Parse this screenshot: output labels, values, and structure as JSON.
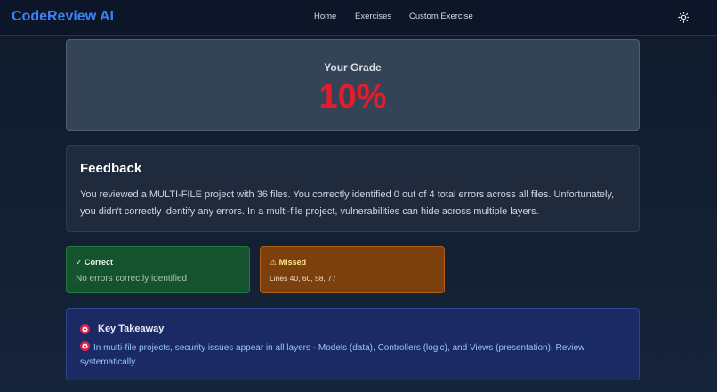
{
  "nav": {
    "brand": "CodeReview AI",
    "links": [
      "Home",
      "Exercises",
      "Custom Exercise"
    ],
    "theme_icon": "sun-icon"
  },
  "grade": {
    "label": "Your Grade",
    "value": "10%",
    "color": "#e11d2e"
  },
  "feedback": {
    "title": "Feedback",
    "text": "You reviewed a MULTI-FILE project with 36 files. You correctly identified 0 out of 4 total errors across all files. Unfortunately, you didn't correctly identify any errors. In a multi-file project, vulnerabilities can hide across multiple layers."
  },
  "correct": {
    "title": "✓ Correct",
    "text": "No errors correctly identified",
    "color": "#14532d"
  },
  "missed": {
    "title": "⚠ Missed",
    "text": "Lines 40, 60, 58, 77",
    "color": "#7c3f0e"
  },
  "takeaway": {
    "title": "Key Takeaway",
    "text": "In multi-file projects, security issues appear in all layers - Models (data), Controllers (logic), and Views (presentation). Review systematically.",
    "icon": "target-icon"
  }
}
